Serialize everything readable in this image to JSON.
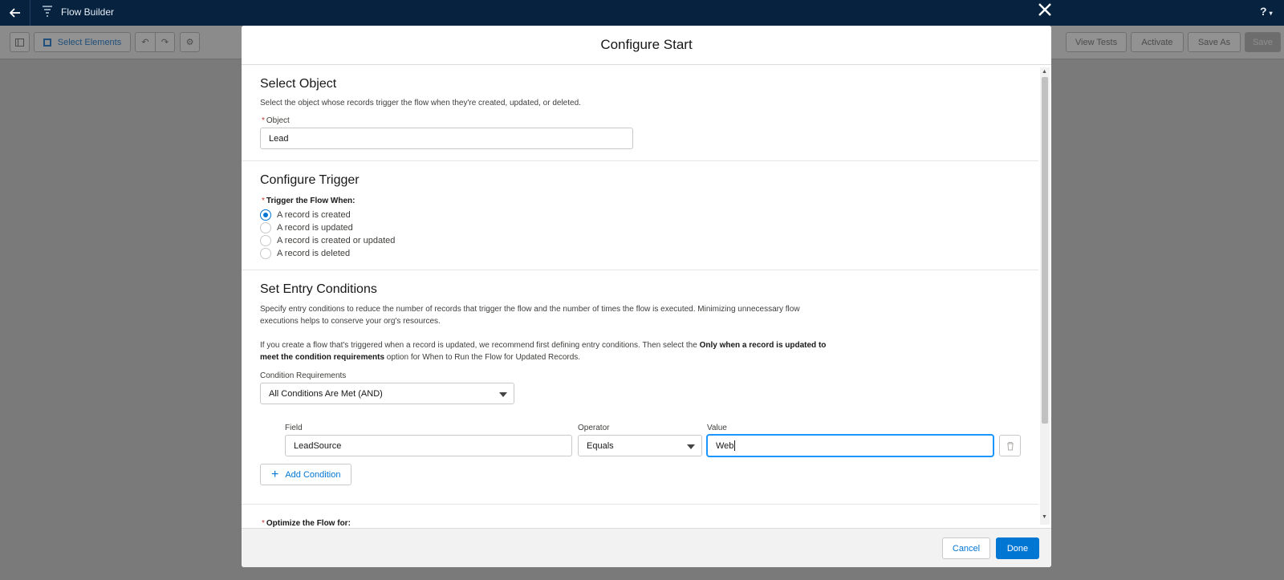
{
  "app": {
    "title": "Flow Builder",
    "help_label": "?"
  },
  "toolbar": {
    "select_elements_label": "Select Elements",
    "view_tests_label": "View Tests",
    "activate_label": "Activate",
    "save_as_label": "Save As",
    "save_label": "Save"
  },
  "modal": {
    "title": "Configure Start",
    "select_object": {
      "heading": "Select Object",
      "description": "Select the object whose records trigger the flow when they're created, updated, or deleted.",
      "required_mark": "*",
      "object_label": "Object",
      "object_value": "Lead"
    },
    "configure_trigger": {
      "heading": "Configure Trigger",
      "required_mark": "*",
      "trigger_label": "Trigger the Flow When:",
      "options": [
        {
          "label": "A record is created",
          "checked": true
        },
        {
          "label": "A record is updated",
          "checked": false
        },
        {
          "label": "A record is created or updated",
          "checked": false
        },
        {
          "label": "A record is deleted",
          "checked": false
        }
      ]
    },
    "entry_conditions": {
      "heading": "Set Entry Conditions",
      "description_1a": "Specify entry conditions to reduce the number of records that trigger the flow and the number of times the flow is executed. Minimizing unnecessary flow",
      "description_1b": "executions helps to conserve your org's resources.",
      "description_2a_pre": "If you create a flow that's triggered when a record is updated, we recommend first defining entry conditions. Then select the ",
      "description_2a_bold": "Only when a record is updated to",
      "description_2b_bold": "meet the condition requirements",
      "description_2b_post": " option for When to Run the Flow for Updated Records.",
      "condition_requirements_label": "Condition Requirements",
      "condition_requirements_value": "All Conditions Are Met (AND)",
      "field_label": "Field",
      "field_value": "LeadSource",
      "operator_label": "Operator",
      "operator_value": "Equals",
      "value_label": "Value",
      "value_value": "Web",
      "add_condition_label": "Add Condition"
    },
    "optimize": {
      "required_mark": "*",
      "label": "Optimize the Flow for:"
    },
    "footer": {
      "cancel_label": "Cancel",
      "done_label": "Done"
    }
  },
  "colors": {
    "brand": "#0176d3",
    "nav_bg": "#06223e",
    "required": "#c23934"
  }
}
